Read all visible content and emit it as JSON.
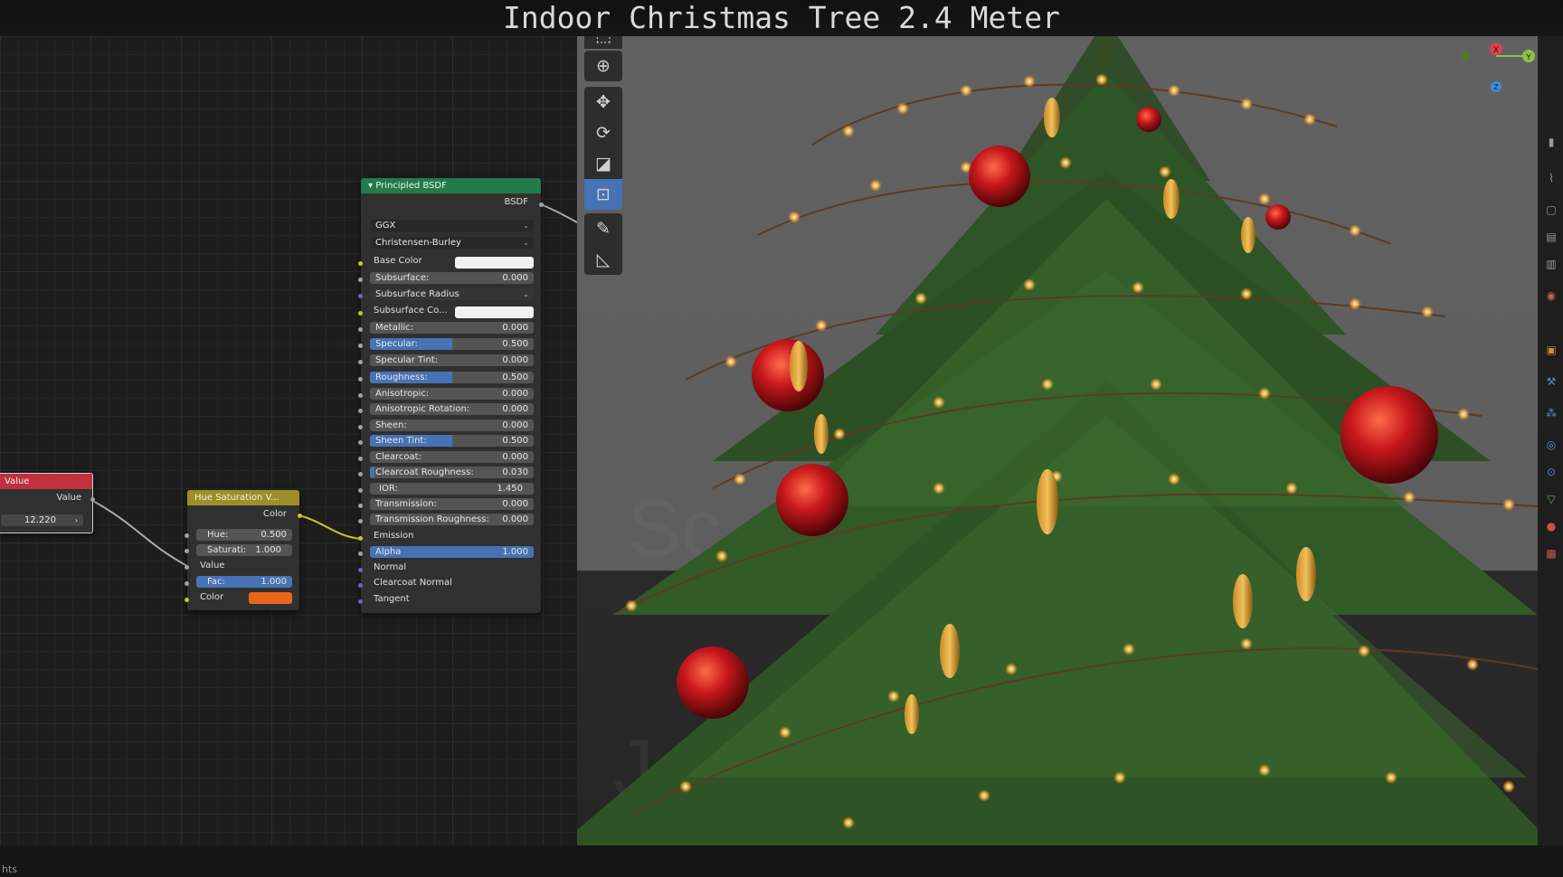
{
  "title": "Indoor Christmas Tree 2.4 Meter",
  "status_text": "hts",
  "colors": {
    "value_header": "#c0303f",
    "hue_header": "#9c8f28",
    "bsdf_header": "#237a4b",
    "accent_blue": "#4772b3",
    "orange_swatch": "#e8661a"
  },
  "value_node": {
    "header": "Value",
    "output_label": "Value",
    "field_value": "12.220"
  },
  "hue_node": {
    "header": "Hue Saturation V...",
    "output_label": "Color",
    "hue_label": "Hue:",
    "hue_value": "0.500",
    "sat_label": "Saturati:",
    "sat_value": "1.000",
    "value_label": "Value",
    "fac_label": "Fac:",
    "fac_value": "1.000",
    "fac_fraction": 1.0,
    "color_label": "Color"
  },
  "bsdf_node": {
    "header": "Principled BSDF",
    "output_label": "BSDF",
    "distribution": "GGX",
    "subsurface_method": "Christensen-Burley",
    "base_color_label": "Base Color",
    "subsurface_label": "Subsurface:",
    "subsurface_value": "0.000",
    "subsurface_radius_label": "Subsurface Radius",
    "subsurface_color_label": "Subsurface Co...",
    "metallic_label": "Metallic:",
    "metallic_value": "0.000",
    "specular_label": "Specular:",
    "specular_value": "0.500",
    "specular_tint_label": "Specular Tint:",
    "specular_tint_value": "0.000",
    "roughness_label": "Roughness:",
    "roughness_value": "0.500",
    "anisotropic_label": "Anisotropic:",
    "anisotropic_value": "0.000",
    "aniso_rot_label": "Anisotropic Rotation:",
    "aniso_rot_value": "0.000",
    "sheen_label": "Sheen:",
    "sheen_value": "0.000",
    "sheen_tint_label": "Sheen Tint:",
    "sheen_tint_value": "0.500",
    "clearcoat_label": "Clearcoat:",
    "clearcoat_value": "0.000",
    "clearcoat_rough_label": "Clearcoat Roughness:",
    "clearcoat_rough_value": "0.030",
    "ior_label": "IOR:",
    "ior_value": "1.450",
    "transmission_label": "Transmission:",
    "transmission_value": "0.000",
    "transmission_rough_label": "Transmission Roughness:",
    "transmission_rough_value": "0.000",
    "emission_label": "Emission",
    "alpha_label": "Alpha",
    "alpha_value": "1.000",
    "normal_label": "Normal",
    "clearcoat_normal_label": "Clearcoat Normal",
    "tangent_label": "Tangent"
  },
  "toolbar": {
    "tools": [
      {
        "name": "select-tool",
        "icon": "cursor-box-icon"
      },
      {
        "name": "cursor-tool",
        "icon": "crosshair-icon"
      },
      {
        "name": "move-tool",
        "icon": "move-arrows-icon"
      },
      {
        "name": "rotate-tool",
        "icon": "rotate-icon"
      },
      {
        "name": "scale-tool",
        "icon": "scale-icon"
      },
      {
        "name": "transform-tool",
        "icon": "transform-icon"
      },
      {
        "name": "annotate-tool",
        "icon": "pencil-icon"
      },
      {
        "name": "measure-tool",
        "icon": "ruler-icon"
      }
    ]
  },
  "gizmo": {
    "x_label": "X",
    "y_label": "Y",
    "z_label": "Z"
  }
}
